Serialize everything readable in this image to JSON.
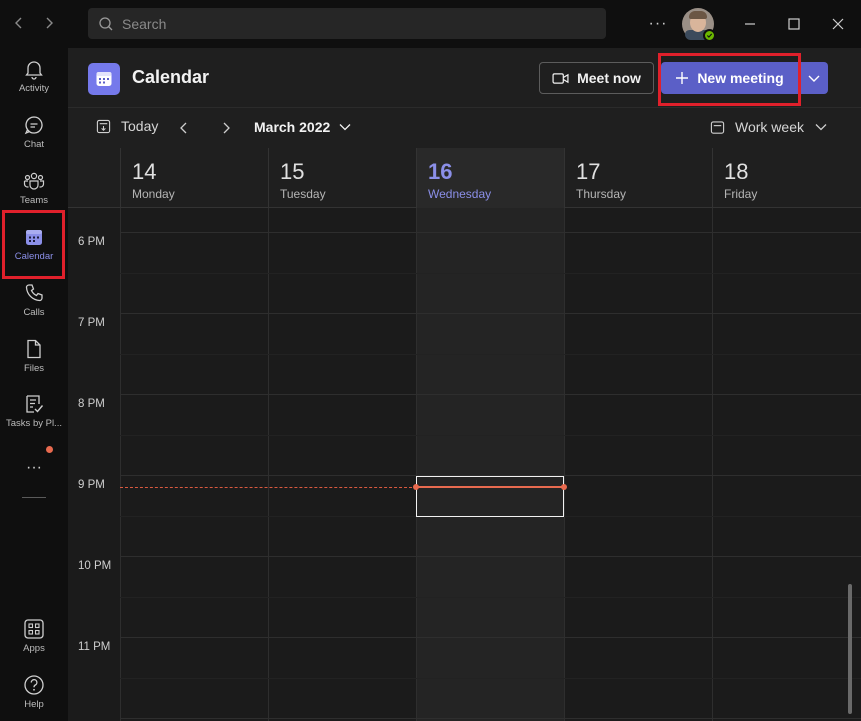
{
  "titlebar": {
    "search_placeholder": "Search",
    "more_label": "···"
  },
  "rail": {
    "items": [
      {
        "label": "Activity"
      },
      {
        "label": "Chat"
      },
      {
        "label": "Teams"
      },
      {
        "label": "Calendar"
      },
      {
        "label": "Calls"
      },
      {
        "label": "Files"
      },
      {
        "label": "Tasks by Pl..."
      },
      {
        "label": "Apps"
      },
      {
        "label": "Help"
      }
    ],
    "more_label": "···",
    "active": "Calendar",
    "notification_color": "#e86a4f"
  },
  "header": {
    "title": "Calendar",
    "meet_now_label": "Meet now",
    "new_meeting_label": "New meeting",
    "accent_color": "#5b5fc7",
    "highlight_color": "#e0202b"
  },
  "toolbar": {
    "today_label": "Today",
    "month_label": "March 2022",
    "view_label": "Work week"
  },
  "days": [
    {
      "num": "14",
      "name": "Monday"
    },
    {
      "num": "15",
      "name": "Tuesday"
    },
    {
      "num": "16",
      "name": "Wednesday"
    },
    {
      "num": "17",
      "name": "Thursday"
    },
    {
      "num": "18",
      "name": "Friday"
    }
  ],
  "today_index": 2,
  "times": [
    "6 PM",
    "7 PM",
    "8 PM",
    "9 PM",
    "10 PM",
    "11 PM"
  ]
}
